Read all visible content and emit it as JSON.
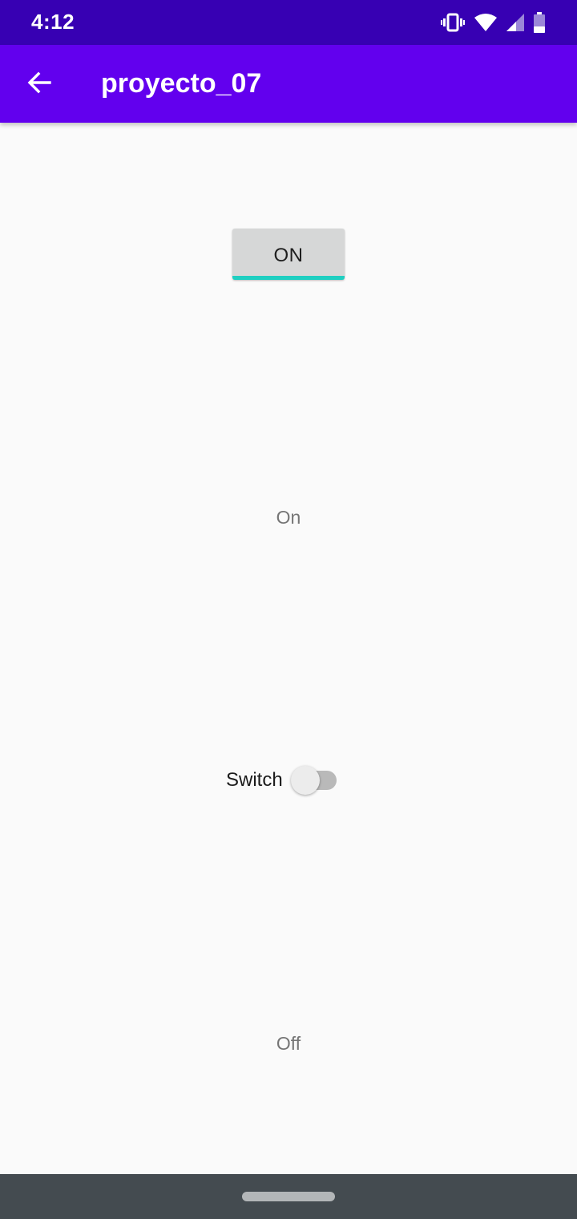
{
  "status_bar": {
    "time": "4:12",
    "icons": [
      "vibrate-icon",
      "wifi-icon",
      "signal-icon",
      "battery-icon"
    ]
  },
  "app_bar": {
    "title": "proyecto_07",
    "back_icon": "arrow-back-icon"
  },
  "toggle_button": {
    "label": "ON",
    "indicator_color": "#1fcfc1"
  },
  "toggle_state_text": "On",
  "switch": {
    "label": "Switch",
    "checked": false
  },
  "switch_state_text": "Off",
  "colors": {
    "status_bar": "#3700b3",
    "app_bar": "#6200ee",
    "background": "#fafafa",
    "nav_bar": "#444b50"
  }
}
